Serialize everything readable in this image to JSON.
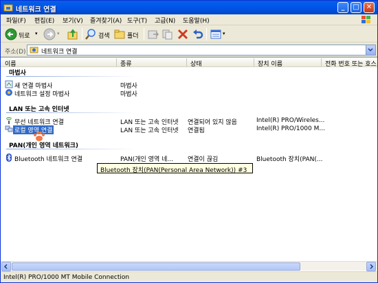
{
  "window": {
    "title": "네트워크 연결"
  },
  "menu": [
    "파일(F)",
    "편집(E)",
    "보기(V)",
    "즐겨찾기(A)",
    "도구(T)",
    "고급(N)",
    "도움말(H)"
  ],
  "toolbar": {
    "back_label": "뒤로",
    "search_label": "검색",
    "folders_label": "폴더"
  },
  "address": {
    "label": "주소(D)",
    "value": "네트워크 연결"
  },
  "columns": [
    "이름",
    "종류",
    "상태",
    "장치 이름",
    "전화 번호 또는 호스"
  ],
  "groups": {
    "wizard": "마법사",
    "lan": "LAN 또는 고속 인터넷",
    "pan": "PAN(개인 영역 네트워크)"
  },
  "rows": {
    "new_wizard": {
      "name": "새 연결 마법사",
      "type": "마법사"
    },
    "net_wizard": {
      "name": "네트워크 설정 마법사",
      "type": "마법사"
    },
    "wireless": {
      "name": "무선 네트워크 연결",
      "type": "LAN 또는 고속 인터넷",
      "status": "연결되어 있지 않음",
      "device": "Intel(R) PRO/Wireles..."
    },
    "local": {
      "name": "로컬 영역 연결",
      "type": "LAN 또는 고속 인터넷",
      "status": "연결됨",
      "device": "Intel(R) PRO/1000 M..."
    },
    "bluetooth": {
      "name": "Bluetooth 네트워크 연결",
      "type": "PAN(개인 영역 네...",
      "status": "연결이 끊김",
      "device": "Bluetooth 장치(PAN(..."
    }
  },
  "tooltip": "Bluetooth 장치(PAN(Personal Area Network)) #3",
  "status_bar": "Intel(R) PRO/1000 MT Mobile Connection",
  "colors": {
    "title_blue": "#0058EE",
    "selection": "#316AC5",
    "tooltip_bg": "#FFFFE1"
  }
}
